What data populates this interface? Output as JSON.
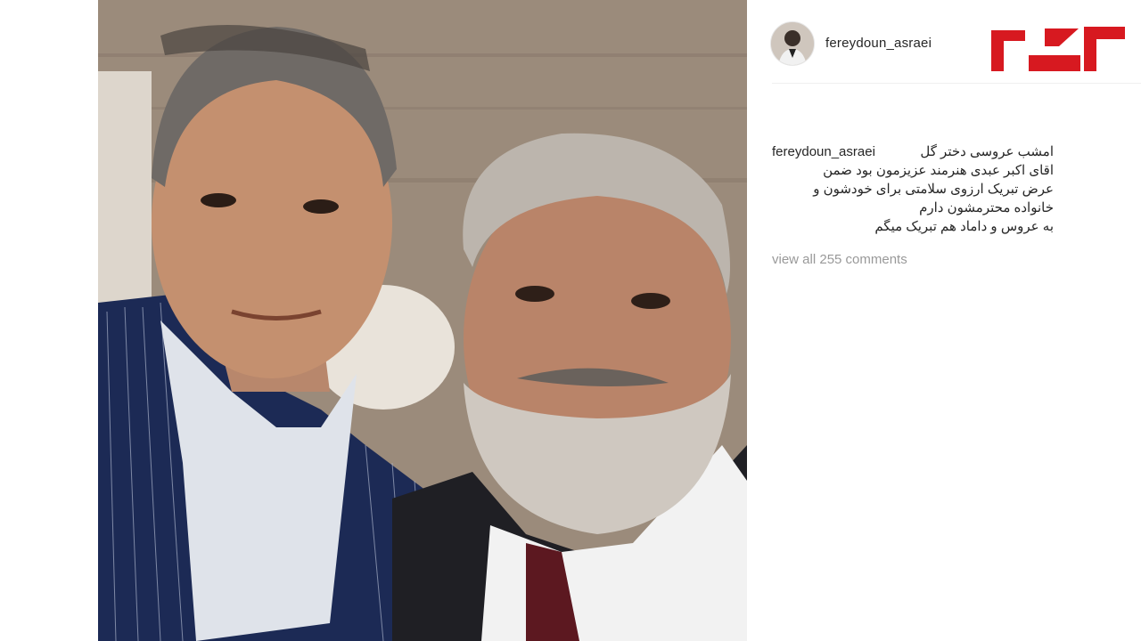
{
  "post": {
    "username": "fereydoun_asraei",
    "caption_lines": [
      "امشب عروسی دختر گل",
      "اقای اکبر عبدی هنرمند عزیزمون بود ضمن",
      "عرض تبریک ارزوی سلامتی برای خودشون و",
      "خانواده محترمشون دارم",
      "به عروس و داماد هم تبریک میگم"
    ],
    "view_comments": "view all 255 comments"
  },
  "brand": {
    "logo_text": "رکنا",
    "logo_color": "#d71920"
  },
  "icons": {
    "avatar": "profile-avatar"
  }
}
